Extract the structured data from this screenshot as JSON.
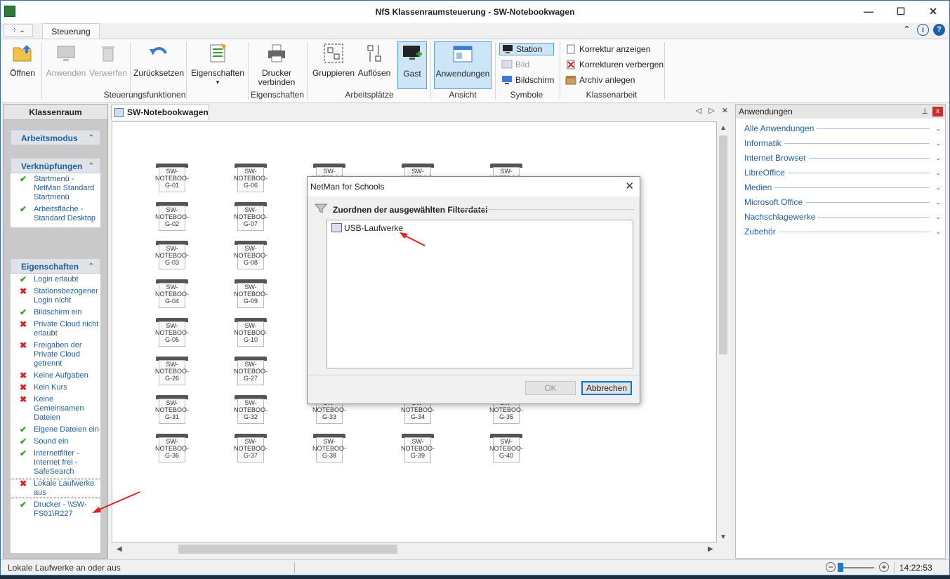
{
  "window": {
    "title": "NfS Klassenraumsteuerung - SW-Notebookwagen",
    "controls": {
      "minimize": "—",
      "maximize": "☐",
      "close": "✕"
    }
  },
  "ribbon": {
    "qat_label": "⁘ ⌄",
    "tab": "Steuerung",
    "top_icons": {
      "collapse": "⌃",
      "info": "i",
      "help": "?"
    },
    "buttons": {
      "oeffnen": "Öffnen",
      "anwenden": "Anwenden",
      "verwerfen": "Verwerfen",
      "zuruecksetzen": "Zurücksetzen",
      "eigenschaften": "Eigenschaften",
      "drucker_verbinden_1": "Drucker",
      "drucker_verbinden_2": "verbinden",
      "gruppieren": "Gruppieren",
      "aufloesen": "Auflösen",
      "gast": "Gast",
      "anwendungen": "Anwendungen",
      "station": "Station",
      "bild": "Bild",
      "bildschirm": "Bildschirm",
      "korrektur_anzeigen": "Korrektur anzeigen",
      "korrekturen_verbergen": "Korrekturen verbergen",
      "archiv_anlegen": "Archiv anlegen",
      "dropdown": "▾"
    },
    "groups": {
      "steuerungsfunktionen": "Steuerungsfunktionen",
      "eigenschaften": "Eigenschaften",
      "arbeitsplaetze": "Arbeitsplätze",
      "ansicht": "Ansicht",
      "symbole": "Symbole",
      "klassenarbeit": "Klassenarbeit"
    }
  },
  "left_panel": {
    "header": "Klassenraum",
    "sections": {
      "arbeitsmodus": "Arbeitsmodus",
      "verknuepfungen": "Verknüpfungen",
      "eigenschaften": "Eigenschaften"
    },
    "collapse_glyph": "⌃",
    "links": [
      {
        "text": "Startmenü - NetMan Standard Startmenü",
        "mark": "✔"
      },
      {
        "text": "Arbeitsfläche - Standard Desktop",
        "mark": "✔"
      }
    ],
    "props": [
      {
        "text": "Login erlaubt",
        "mark": "✔"
      },
      {
        "text": "Stationsbezogener Login nicht",
        "mark": "✖"
      },
      {
        "text": "Bildschirm ein",
        "mark": "✔"
      },
      {
        "text": "Private Cloud nicht erlaubt",
        "mark": "✖"
      },
      {
        "text": "Freigaben der Private Cloud getrennt",
        "mark": "✖"
      },
      {
        "text": "Keine Aufgaben",
        "mark": "✖"
      },
      {
        "text": "Kein Kurs",
        "mark": "✖"
      },
      {
        "text": "Keine Gemeinsamen Dateien",
        "mark": "✖"
      },
      {
        "text": "Eigene Dateien ein",
        "mark": "✔"
      },
      {
        "text": "Sound ein",
        "mark": "✔"
      },
      {
        "text": "Internetfilter - Internet frei - SafeSearch",
        "mark": "✔"
      },
      {
        "text": "Lokale Laufwerke aus",
        "mark": "✖"
      },
      {
        "text": "Drucker - \\\\SW-FS01\\R227",
        "mark": "✔"
      }
    ]
  },
  "document": {
    "tab": "SW-Notebookwagen",
    "nav": {
      "prev": "◁",
      "next": "▷",
      "close": "✕"
    },
    "scroll": {
      "up": "▲",
      "down": "▼",
      "left": "◀",
      "right": "▶"
    },
    "stations": [
      {
        "name": "SW-\nNOTEBOO-\nG-01"
      },
      {
        "name": "SW-\nNOTEBOO-\nG-06"
      },
      {
        "name": "SW-\nNOTEBOO-\nG-11"
      },
      {
        "name": "SW-\nNOTEBOO-\nG-16"
      },
      {
        "name": "SW-\nNOTEBOO-\nG-21"
      },
      {
        "name": "SW-\nNOTEBOO-\nG-02"
      },
      {
        "name": "SW-\nNOTEBOO-\nG-07"
      },
      {
        "name": "SW-\nNOTEBOO-\nG-03"
      },
      {
        "name": "SW-\nNOTEBOO-\nG-08"
      },
      {
        "name": "SW-\nNOTEBOO-\nG-04"
      },
      {
        "name": "SW-\nNOTEBOO-\nG-09"
      },
      {
        "name": "SW-\nNOTEBOO-\nG-05"
      },
      {
        "name": "SW-\nNOTEBOO-\nG-10"
      },
      {
        "name": "SW-\nNOTEBOO-\nG-26"
      },
      {
        "name": "SW-\nNOTEBOO-\nG-27"
      },
      {
        "name": "SW-\nNOTEBOO-\nG-31"
      },
      {
        "name": "SW-\nNOTEBOO-\nG-32"
      },
      {
        "name": "SW-\nNOTEBOO-\nG-33"
      },
      {
        "name": "SW-\nNOTEBOO-\nG-34"
      },
      {
        "name": "SW-\nNOTEBOO-\nG-35"
      },
      {
        "name": "SW-\nNOTEBOO-\nG-36"
      },
      {
        "name": "SW-\nNOTEBOO-\nG-37"
      },
      {
        "name": "SW-\nNOTEBOO-\nG-38"
      },
      {
        "name": "SW-\nNOTEBOO-\nG-39"
      },
      {
        "name": "SW-\nNOTEBOO-\nG-40"
      }
    ]
  },
  "right_panel": {
    "header": "Anwendungen",
    "pin": "⊥",
    "close": "x",
    "chevron": "⌄",
    "categories": [
      "Alle Anwendungen",
      "Informatik",
      "Internet Browser",
      "LibreOffice",
      "Medien",
      "Microsoft Office",
      "Nachschlagewerke",
      "Zubehör"
    ]
  },
  "dialog": {
    "title": "NetMan for Schools",
    "close": "✕",
    "heading": "Zuordnen der ausgewählten Filterdatei",
    "items": [
      "USB-Laufwerke"
    ],
    "ok": "OK",
    "cancel": "Abbrechen"
  },
  "status": {
    "text": "Lokale Laufwerke an oder aus",
    "time": "14:22:53",
    "zoom_minus": "−",
    "zoom_plus": "+"
  },
  "colors": {
    "accent": "#1f5fa6",
    "check": "#3a9a2a",
    "cross": "#dd2222",
    "annotation_arrow": "#e02020"
  }
}
